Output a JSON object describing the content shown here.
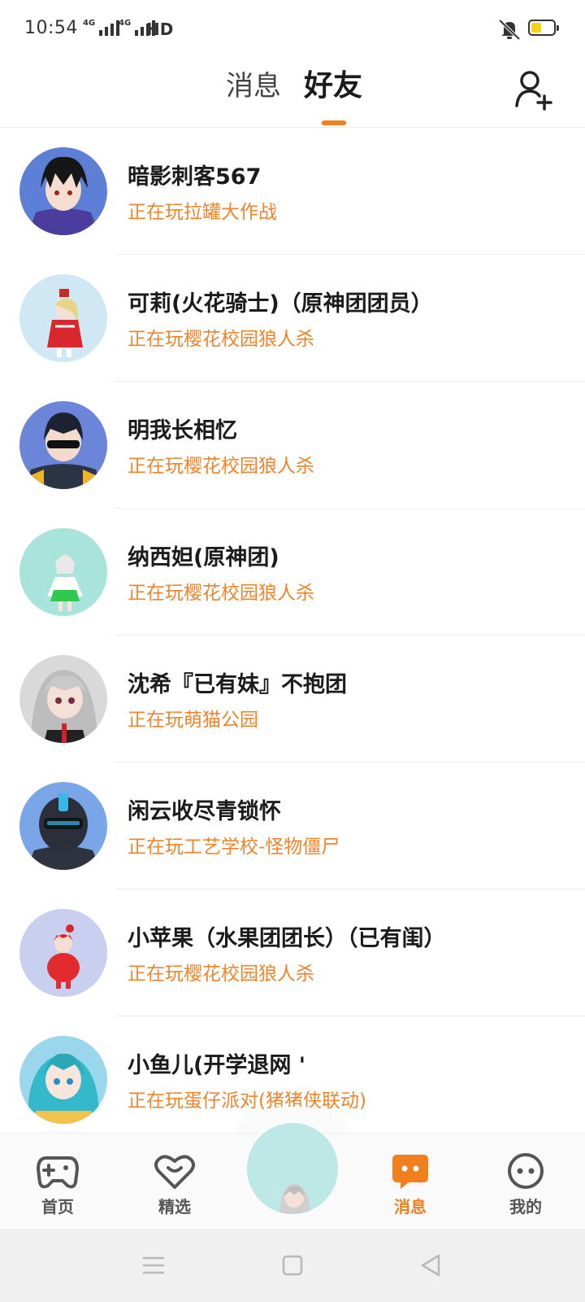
{
  "status_bar": {
    "time": "10:54",
    "network_1": "4G",
    "network_2": "4G",
    "hd_label": "HD",
    "battery_level": 0.45,
    "battery_color": "#f6d115",
    "icons": [
      "signal-icon",
      "bell-off-icon",
      "battery-icon"
    ]
  },
  "header": {
    "tabs": [
      {
        "label": "消息",
        "active": false
      },
      {
        "label": "好友",
        "active": true
      }
    ],
    "accent_color": "#f07f1d",
    "add_friend_icon": "add-user-icon"
  },
  "friends": [
    {
      "name": "暗影刺客567",
      "status": "正在玩拉罐大作战",
      "avatar_bg": "#5d7fd6"
    },
    {
      "name": "可莉(火花骑士)（原神团团员）",
      "status": "正在玩樱花校园狼人杀",
      "avatar_bg": "#cfe8f3"
    },
    {
      "name": "明我长相忆",
      "status": "正在玩樱花校园狼人杀",
      "avatar_bg": "#6b86d8"
    },
    {
      "name": "纳西妲(原神团)",
      "status": "正在玩樱花校园狼人杀",
      "avatar_bg": "#a9e4dc"
    },
    {
      "name": "沈希『已有妹』不抱团",
      "status": "正在玩萌猫公园",
      "avatar_bg": "#d9d9d9"
    },
    {
      "name": "闲云收尽青锁怀",
      "status": "正在玩工艺学校-怪物僵尸",
      "avatar_bg": "#7aa5e6"
    },
    {
      "name": "小苹果（水果团团长）（已有闺）",
      "status": "正在玩樱花校园狼人杀",
      "avatar_bg": "#c9cfee"
    },
    {
      "name": "小鱼儿(开学退网 '",
      "status": "正在玩蛋仔派对(猪猪侠联动)",
      "avatar_bg": "#9ad6ec"
    }
  ],
  "bottom_nav": {
    "items": [
      {
        "label": "首页",
        "icon": "gamepad-icon",
        "active": false
      },
      {
        "label": "精选",
        "icon": "heart-icon",
        "active": false
      },
      {
        "label": "消息",
        "icon": "chat-icon",
        "active": true
      },
      {
        "label": "我的",
        "icon": "face-icon",
        "active": false
      }
    ],
    "center_icon": "profile-avatar"
  },
  "system_nav": {
    "icons": [
      "menu-icon",
      "home-square-icon",
      "back-triangle-icon"
    ]
  }
}
